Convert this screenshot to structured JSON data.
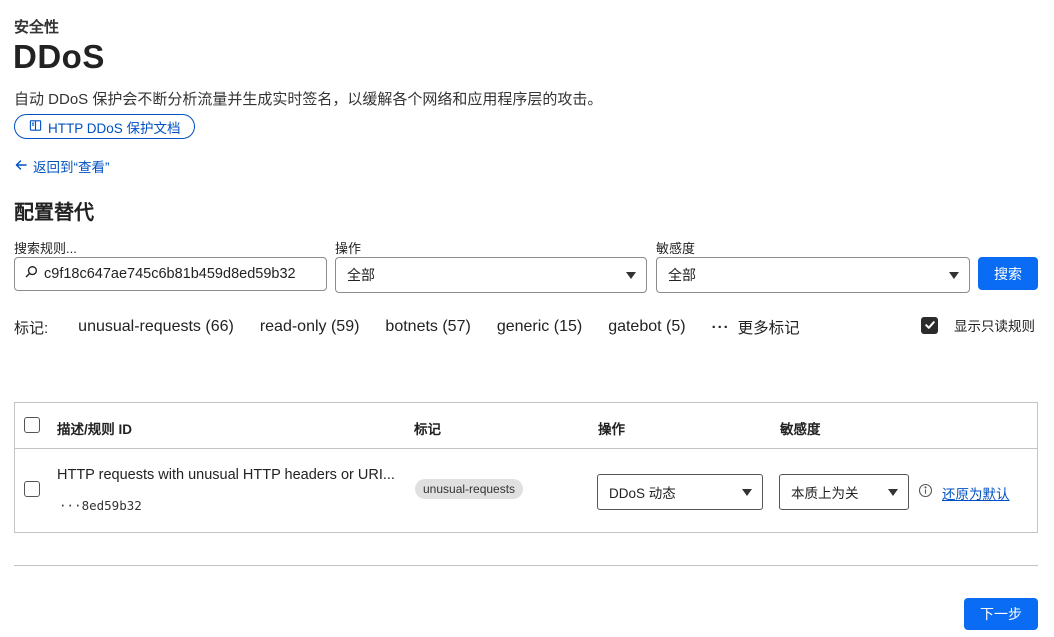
{
  "header": {
    "eyebrow": "安全性",
    "title": "DDoS",
    "description": "自动 DDoS 保护会不断分析流量并生成实时签名，以缓解各个网络和应用程序层的攻击。",
    "docs_link": "HTTP DDoS 保护文档",
    "back_link": "返回到“查看”"
  },
  "section": {
    "title": "配置替代"
  },
  "filters": {
    "search_label": "搜索规则...",
    "search_value": "c9f18c647ae745c6b81b459d8ed59b32",
    "action_label": "操作",
    "action_value": "全部",
    "sensitivity_label": "敏感度",
    "sensitivity_value": "全部",
    "search_button": "搜索"
  },
  "tags": {
    "label": "标记:",
    "items": [
      "unusual-requests (66)",
      "read-only (59)",
      "botnets (57)",
      "generic (15)",
      "gatebot (5)"
    ],
    "more_dots": "···",
    "more_label": "更多标记",
    "show_readonly_label": "显示只读规则",
    "show_readonly_checked": true
  },
  "table": {
    "columns": [
      "描述/规则 ID",
      "标记",
      "操作",
      "敏感度"
    ],
    "rows": [
      {
        "description": "HTTP requests with unusual HTTP headers or URI...",
        "rule_id": "···8ed59b32",
        "tag": "unusual-requests",
        "action": "DDoS 动态",
        "sensitivity": "本质上为关",
        "restore_link": "还原为默认"
      }
    ]
  },
  "footer": {
    "next_button": "下一步"
  },
  "colors": {
    "link": "#0051c3",
    "primary_button": "#0a6cf5",
    "border": "#c4c4c4"
  }
}
